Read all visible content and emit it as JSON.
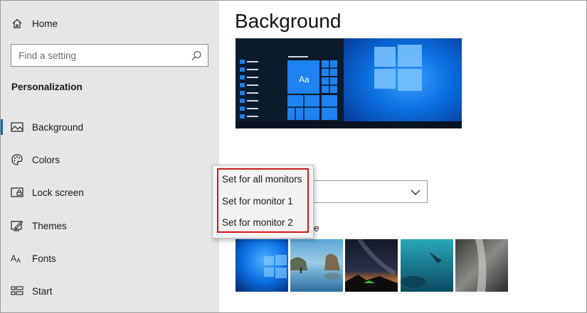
{
  "sidebar": {
    "home_label": "Home",
    "search_placeholder": "Find a setting",
    "section_title": "Personalization",
    "items": [
      {
        "label": "Background",
        "icon": "picture-icon",
        "selected": true
      },
      {
        "label": "Colors",
        "icon": "palette-icon"
      },
      {
        "label": "Lock screen",
        "icon": "lock-screen-icon"
      },
      {
        "label": "Themes",
        "icon": "themes-icon"
      },
      {
        "label": "Fonts",
        "icon": "fonts-icon"
      },
      {
        "label": "Start",
        "icon": "start-icon"
      }
    ]
  },
  "main": {
    "title": "Background",
    "choose_picture_label_visible": "ure",
    "preview_tile_text": "Aa"
  },
  "context_menu": {
    "items": [
      "Set for all monitors",
      "Set for monitor 1",
      "Set for monitor 2"
    ]
  },
  "colors": {
    "accent": "#0a66c2",
    "highlight_border": "#d0191d",
    "sidebar_bg": "#e6e6e6"
  }
}
